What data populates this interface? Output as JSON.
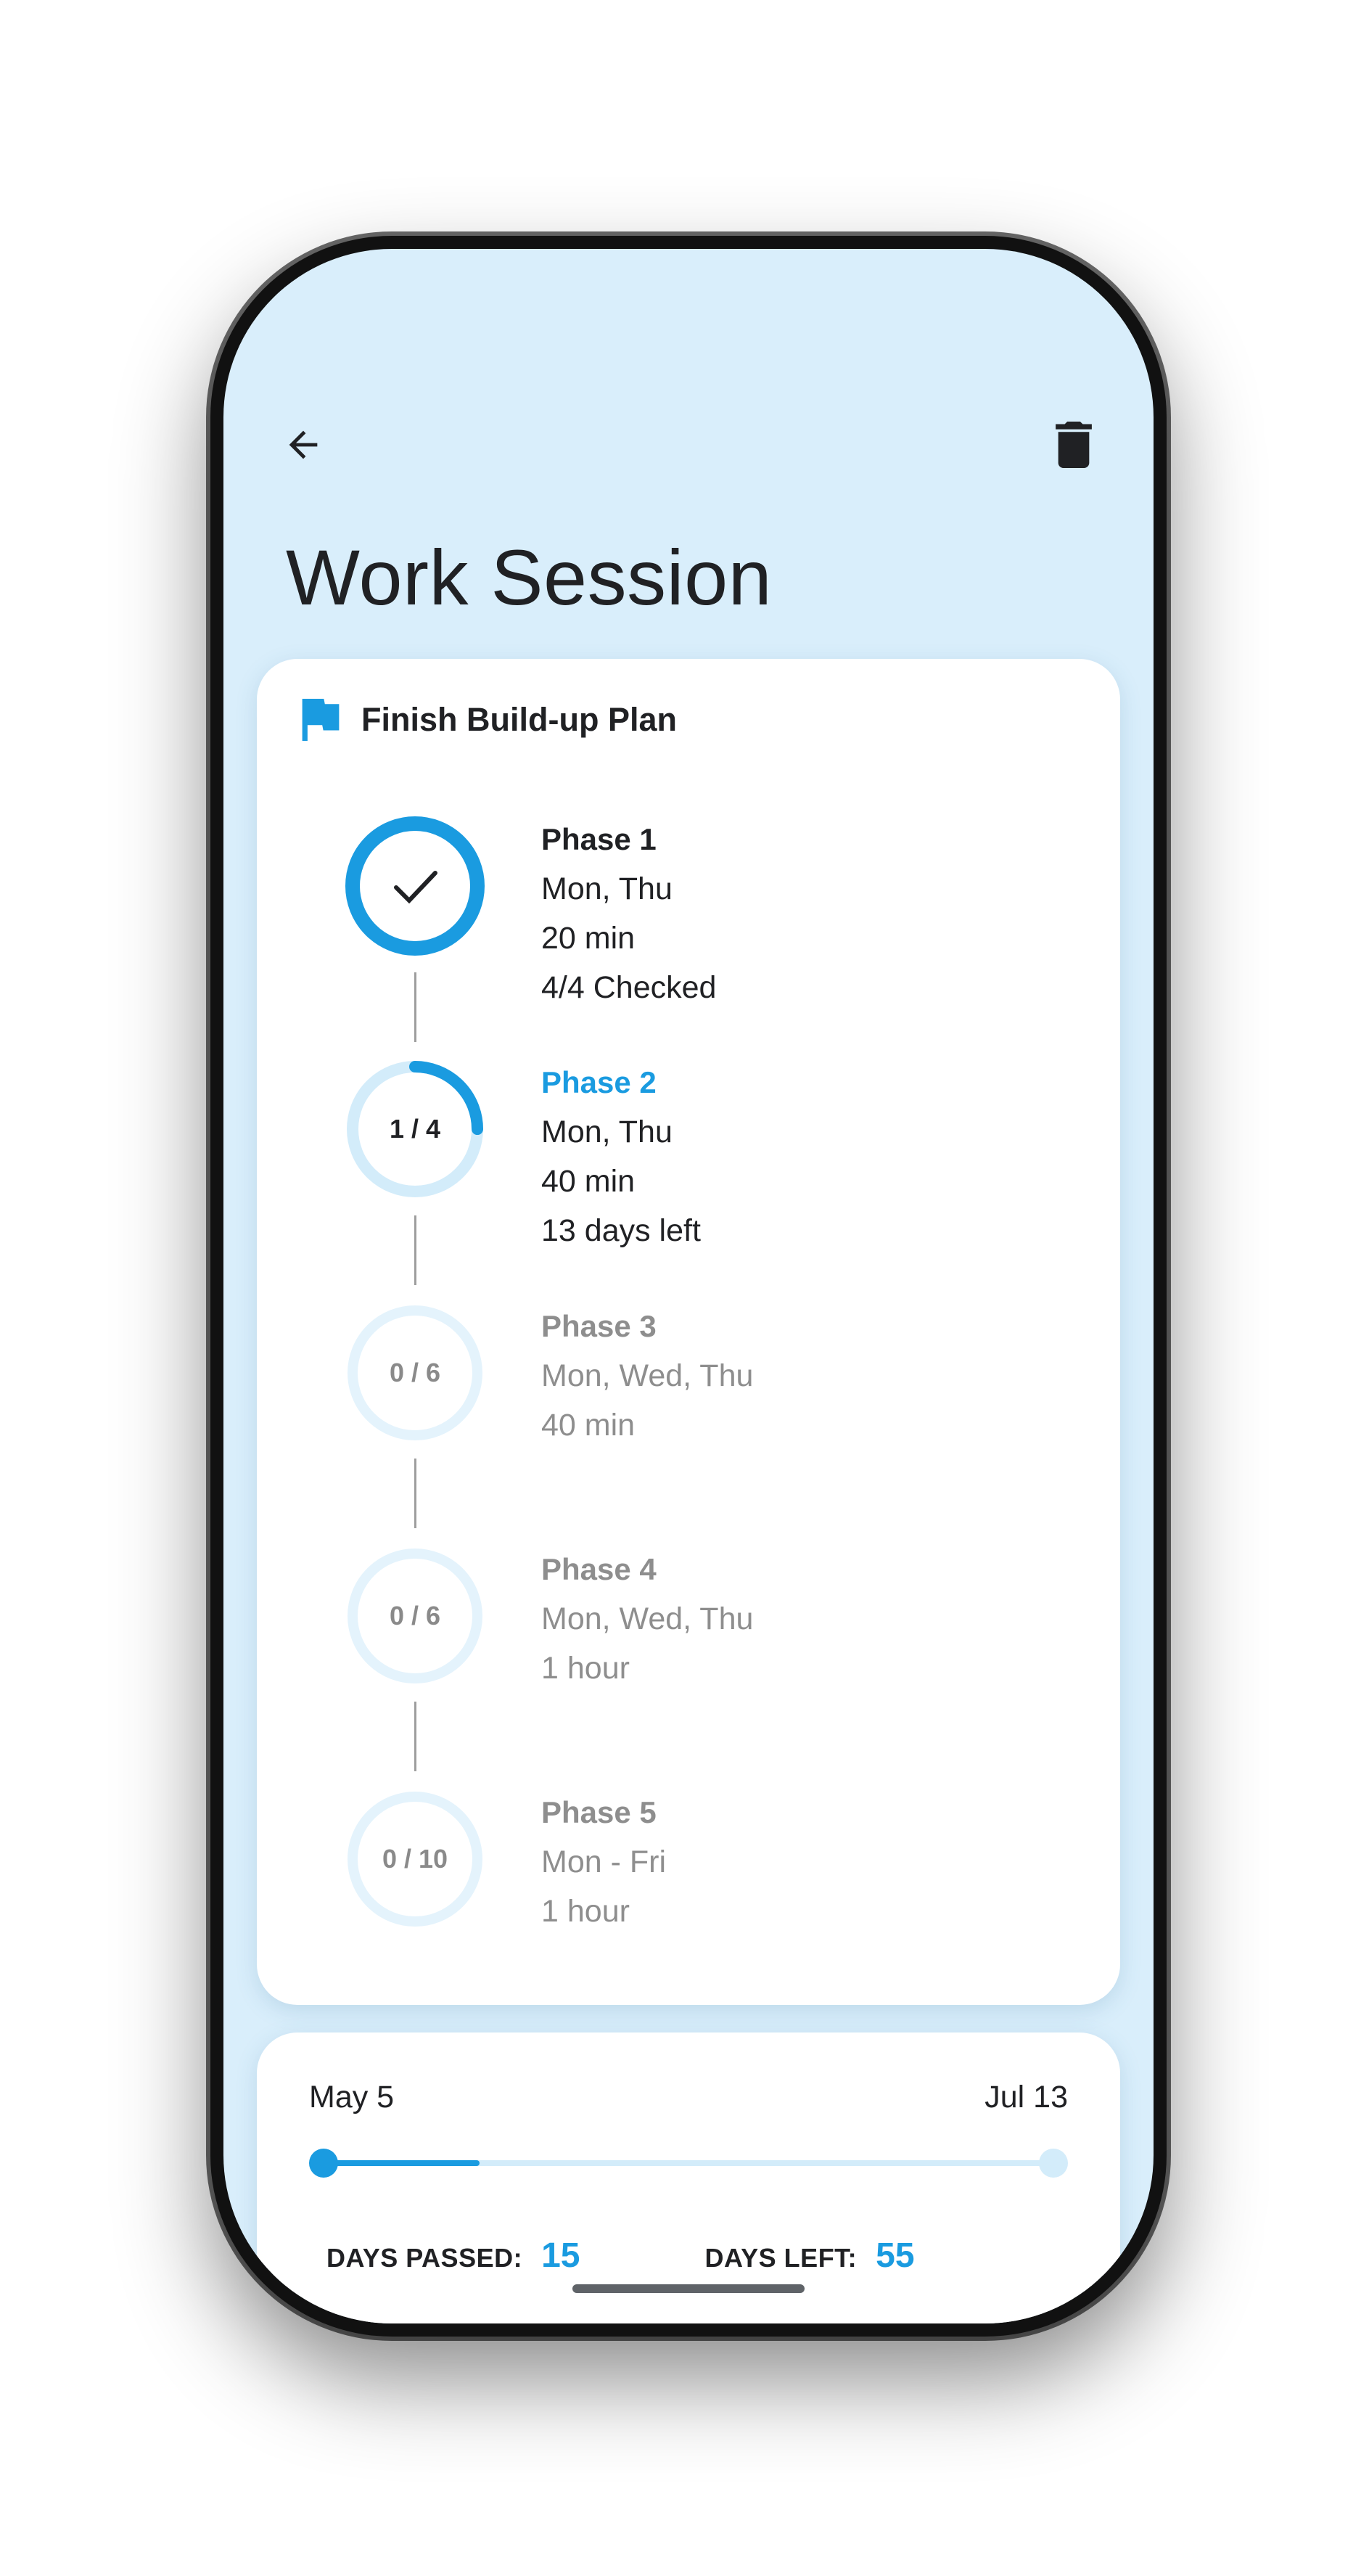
{
  "header": {
    "title": "Work Session",
    "back_icon": "arrow-left-icon",
    "delete_icon": "trash-icon"
  },
  "plan": {
    "title": "Finish Build-up Plan",
    "flag_icon": "flag-icon",
    "accent_color": "#1a9be0",
    "phases": [
      {
        "name": "Phase 1",
        "days": "Mon, Thu",
        "duration": "20 min",
        "status_text": "4/4 Checked",
        "progress_label": "",
        "completed": 4,
        "total": 4,
        "state": "done"
      },
      {
        "name": "Phase 2",
        "days": "Mon, Thu",
        "duration": "40 min",
        "status_text": "13 days left",
        "progress_label": "1 / 4",
        "completed": 1,
        "total": 4,
        "state": "active"
      },
      {
        "name": "Phase 3",
        "days": "Mon, Wed, Thu",
        "duration": "40 min",
        "status_text": "",
        "progress_label": "0 / 6",
        "completed": 0,
        "total": 6,
        "state": "future"
      },
      {
        "name": "Phase 4",
        "days": "Mon, Wed, Thu",
        "duration": "1 hour",
        "status_text": "",
        "progress_label": "0 / 6",
        "completed": 0,
        "total": 6,
        "state": "future"
      },
      {
        "name": "Phase 5",
        "days": "Mon - Fri",
        "duration": "1 hour",
        "status_text": "",
        "progress_label": "0 / 10",
        "completed": 0,
        "total": 10,
        "state": "future"
      }
    ]
  },
  "timeline": {
    "start_date": "May 5",
    "end_date": "Jul 13",
    "progress_fraction": 0.214,
    "days_passed_label": "DAYS PASSED:",
    "days_passed": "15",
    "days_left_label": "DAYS LEFT:",
    "days_left": "55"
  }
}
